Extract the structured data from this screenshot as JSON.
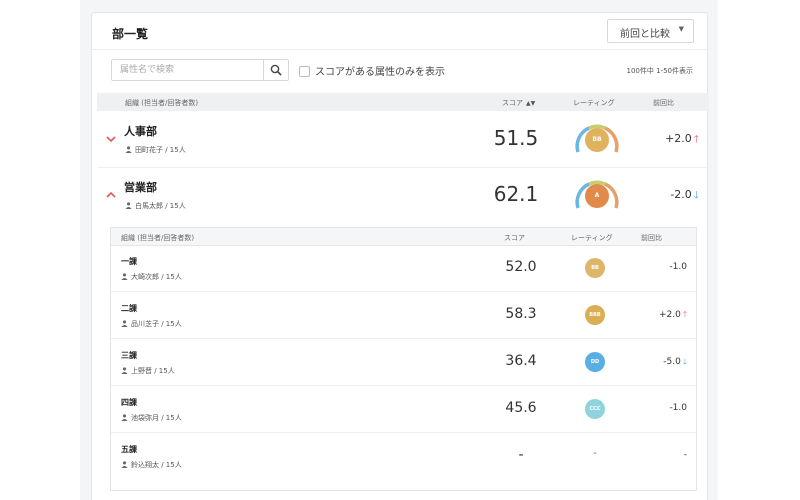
{
  "panel": {
    "title": "部一覧",
    "compare_select": {
      "selected": "前回と比較"
    },
    "search": {
      "placeholder": "属性名で検索",
      "value": ""
    },
    "filter_checkbox_label": "スコアがある属性のみを表示",
    "count_text": "100件中 1-50件表示"
  },
  "table": {
    "headers": {
      "org": "組織 (担当者/回答者数)",
      "score": "スコア",
      "rating": "レーティング",
      "change": "前回比"
    }
  },
  "departments": [
    {
      "name": "人事部",
      "meta": "田町花子 / 15人",
      "score": "51.5",
      "rating": "BB",
      "rating_color": "#e0b25e",
      "change": "+2.0",
      "direction": "up",
      "expanded": false
    },
    {
      "name": "営業部",
      "meta": "白馬太郎 / 15人",
      "score": "62.1",
      "rating": "A",
      "rating_color": "#e28a4a",
      "change": "-2.0",
      "direction": "down",
      "expanded": true
    }
  ],
  "sub_table": {
    "headers": {
      "org": "組織 (担当者/回答者数)",
      "score": "スコア",
      "rating": "レーティング",
      "change": "前回比"
    },
    "rows": [
      {
        "name": "一課",
        "meta": "大崎次郎 / 15人",
        "score": "52.0",
        "rating": "BB",
        "rating_color": "#ddb66a",
        "change": "-1.0",
        "direction": "none"
      },
      {
        "name": "二課",
        "meta": "品川芝子 / 15人",
        "score": "58.3",
        "rating": "BBB",
        "rating_color": "#d9ae55",
        "change": "+2.0",
        "direction": "up"
      },
      {
        "name": "三課",
        "meta": "上野晋 / 15人",
        "score": "36.4",
        "rating": "DD",
        "rating_color": "#59aee3",
        "change": "-5.0",
        "direction": "down"
      },
      {
        "name": "四課",
        "meta": "池袋弥月 / 15人",
        "score": "45.6",
        "rating": "CCC",
        "rating_color": "#8fd3dc",
        "change": "-1.0",
        "direction": "none"
      },
      {
        "name": "五課",
        "meta": "鈴込翔太 / 15人",
        "score": "-",
        "rating": "-",
        "rating_color": "",
        "change": "-",
        "direction": "none"
      }
    ]
  },
  "colors": {
    "accent_up": "#e05a4f",
    "accent_down": "#4aa3df",
    "toggle": "#e05a4f"
  },
  "icons": [
    "chevron-down-icon",
    "chevron-up-icon",
    "search-icon",
    "person-icon",
    "sort-icon",
    "arrow-up-icon",
    "arrow-down-icon",
    "caret-down-icon"
  ]
}
